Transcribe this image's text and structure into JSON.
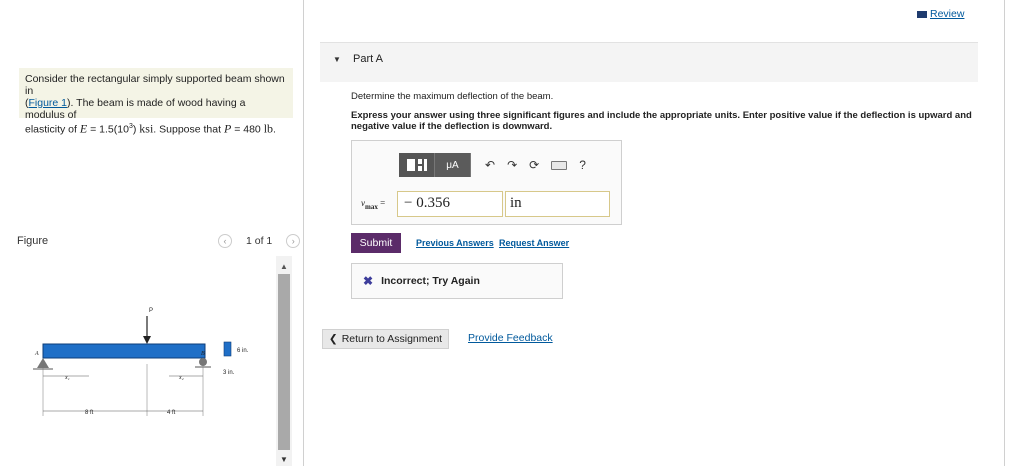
{
  "problem": {
    "line1": "Consider the rectangular simply supported beam shown in",
    "figure_link": "Figure 1",
    "line2_rest": ". The beam is made of wood having a modulus of",
    "line3_pre": "elasticity of",
    "E_symbol": "E",
    "E_value": "= 1.5(10",
    "E_exp": "3",
    "E_close": ")",
    "E_unit": "ksi",
    "suppose": ". Suppose that",
    "P_symbol": "P",
    "P_value": "= 480",
    "P_unit": "lb",
    "end": "."
  },
  "figure": {
    "label": "Figure",
    "page_text": "1 of 1",
    "prev_icon": "chevron-left-icon",
    "next_icon": "chevron-right-icon",
    "labels": {
      "P": "P",
      "A": "A",
      "B": "B",
      "x1": "x₁",
      "x2": "x₂",
      "d1": "8 ft",
      "d2": "4 ft",
      "h": "6 in.",
      "b": "3 in."
    },
    "beam_color": "#1f6fc7"
  },
  "header": {
    "review_label": "Review",
    "review_icon": "book-icon"
  },
  "part": {
    "title": "Part A",
    "arrow_icon": "caret-down-icon"
  },
  "question": {
    "text": "Determine the maximum deflection of the beam.",
    "instructions": "Express your answer using three significant figures and include the appropriate units. Enter positive value if the deflection is upward and negative value if the deflection is downward."
  },
  "answer": {
    "var_name": "v",
    "var_sub": "max",
    "equals": "=",
    "value": "− 0.356",
    "unit": "in",
    "toolbar": {
      "template_icon": "template-icon",
      "mu_label": "μA",
      "undo_icon": "undo-icon",
      "redo_icon": "redo-icon",
      "reset_icon": "reset-icon",
      "keyboard_icon": "keyboard-icon",
      "help_label": "?"
    }
  },
  "actions": {
    "submit": "Submit",
    "previous_answers": "Previous Answers",
    "request_answer": "Request Answer"
  },
  "feedback": {
    "icon": "x-icon",
    "text": "Incorrect; Try Again"
  },
  "footer": {
    "return_label": "Return to Assignment",
    "provide_feedback": "Provide Feedback"
  }
}
